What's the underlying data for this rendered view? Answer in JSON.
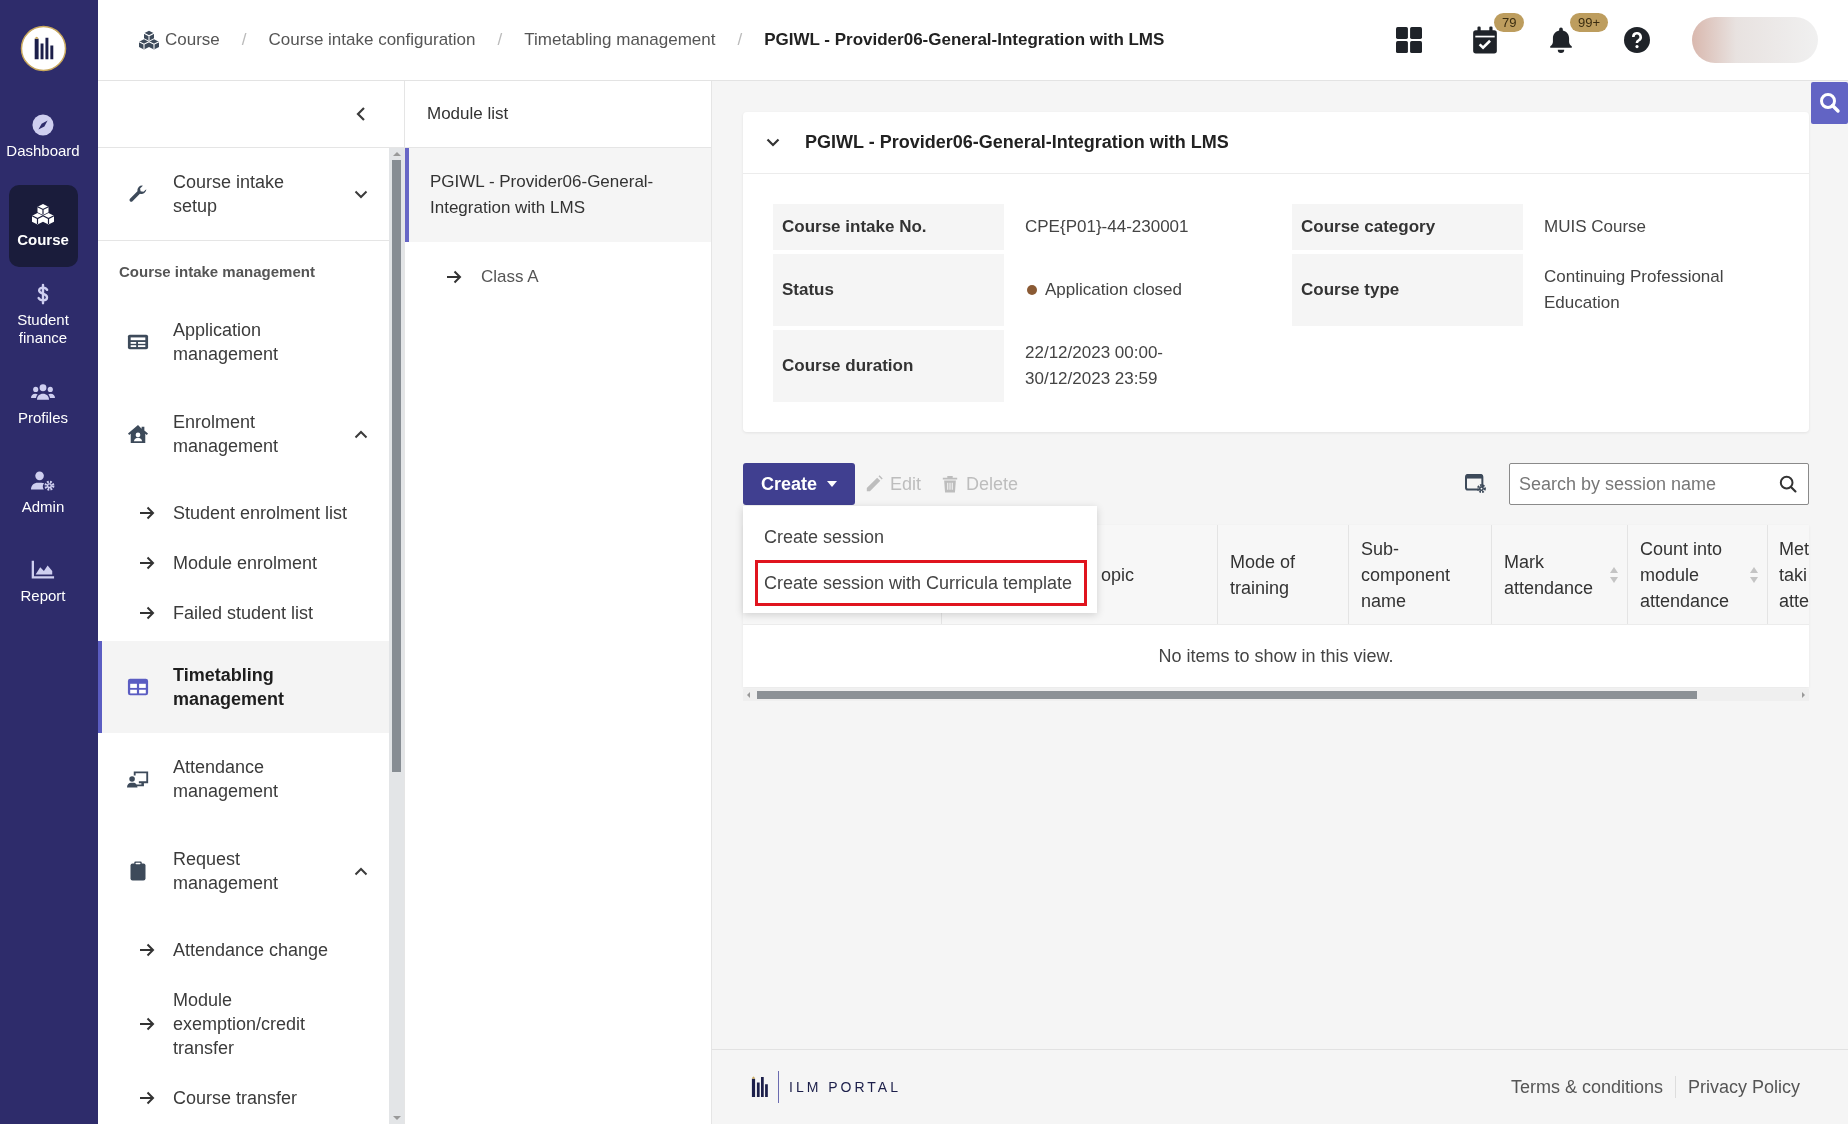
{
  "nav": [
    {
      "label": "Dashboard",
      "selected": false
    },
    {
      "label": "Course",
      "selected": true
    },
    {
      "label": "Student finance",
      "selected": false
    },
    {
      "label": "Profiles",
      "selected": false
    },
    {
      "label": "Admin",
      "selected": false
    },
    {
      "label": "Report",
      "selected": false
    }
  ],
  "breadcrumb": [
    {
      "label": "Course"
    },
    {
      "separator": "/",
      "label": "Course intake configuration"
    },
    {
      "separator": "/",
      "label": "Timetabling management"
    },
    {
      "separator": "/",
      "label": "PGIWL - Provider06-General-Integration with LMS"
    }
  ],
  "header": {
    "calendar_badge": "79",
    "notification_badge": "99+"
  },
  "sidebar": {
    "top_items": [
      {
        "label": "Course intake setup",
        "selected": false,
        "expanded": false
      }
    ],
    "section_title": "Course intake management",
    "items": [
      {
        "label": "Application management",
        "selected": false
      },
      {
        "label": "Enrolment management",
        "selected": false,
        "expanded": true,
        "children": [
          {
            "label": "Student enrolment list",
            "selected": false
          },
          {
            "label": "Module enrolment",
            "selected": false
          },
          {
            "label": "Failed student list",
            "selected": false
          }
        ]
      },
      {
        "label": "Timetabling management",
        "selected": true
      },
      {
        "label": "Attendance management",
        "selected": false
      },
      {
        "label": "Request management",
        "selected": false,
        "expanded": true,
        "children": [
          {
            "label": "Attendance change",
            "selected": false
          },
          {
            "label": "Module exemption/credit transfer",
            "selected": false
          },
          {
            "label": "Course transfer",
            "selected": false
          }
        ]
      }
    ]
  },
  "module_list": {
    "title": "Module list",
    "items": [
      {
        "label": "PGIWL - Provider06-General-Integration with LMS",
        "selected": true,
        "children": [
          {
            "label": "Class A",
            "selected": false
          }
        ]
      }
    ]
  },
  "course_card": {
    "title": "PGIWL - Provider06-General-Integration with LMS",
    "expanded": true,
    "fields": [
      {
        "label": "Course intake No.",
        "value": "CPE{P01}-44-230001"
      },
      {
        "label": "Status",
        "value": "Application closed",
        "color": "#8a5a34"
      },
      {
        "label": "Course duration",
        "value": "22/12/2023 00:00-\n30/12/2023 23:59"
      },
      {
        "label": "Course category",
        "value": "MUIS Course"
      },
      {
        "label": "Course type",
        "value": "Continuing Professional Education"
      }
    ]
  },
  "toolbar": {
    "buttons": [
      {
        "label": "Create",
        "kind": "primary",
        "disabled": false
      },
      {
        "label": "Edit",
        "kind": "plain",
        "disabled": true
      },
      {
        "label": "Delete",
        "kind": "plain",
        "disabled": true
      }
    ],
    "search": {
      "placeholder": "Search by session name"
    }
  },
  "create_menu": {
    "open": true,
    "items": [
      {
        "label": "Create session",
        "highlighted": false
      },
      {
        "label": "Create session with Curricula template",
        "highlighted": true
      }
    ]
  },
  "sessions_table": {
    "columns": [
      {
        "label": "opic",
        "sortable": false
      },
      {
        "label": "Mode of training",
        "sortable": false
      },
      {
        "label": "Sub-component name",
        "sortable": false
      },
      {
        "label": "Mark attendance",
        "sortable": true
      },
      {
        "label": "Count into module attendance",
        "sortable": true
      },
      {
        "label": "Met taki atte",
        "sortable": false
      }
    ],
    "empty_message": "No items to show in this view."
  },
  "footer": {
    "brand": "ILM PORTAL",
    "links": [
      "Terms & conditions",
      "Privacy Policy"
    ]
  }
}
